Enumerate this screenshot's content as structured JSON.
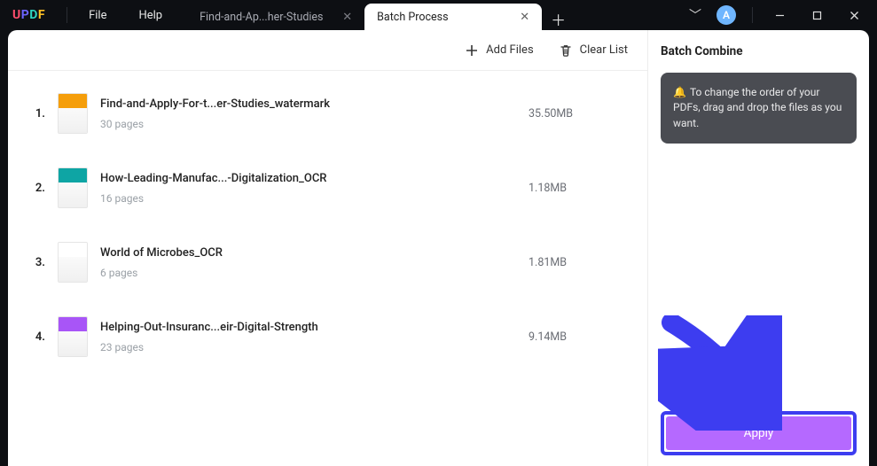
{
  "brand": {
    "u": "U",
    "p": "P",
    "d": "D",
    "f": "F"
  },
  "menus": {
    "file": "File",
    "help": "Help"
  },
  "tabs": {
    "inactive_label": "Find-and-Ap...her-Studies",
    "active_label": "Batch Process"
  },
  "avatar_initial": "A",
  "toolbar": {
    "add_files": "Add Files",
    "clear_list": "Clear List"
  },
  "files": [
    {
      "idx": "1.",
      "name": "Find-and-Apply-For-t...er-Studies_watermark",
      "pages": "30 pages",
      "size": "35.50MB",
      "thumb_color": "#f59e0b"
    },
    {
      "idx": "2.",
      "name": "How-Leading-Manufac...-Digitalization_OCR",
      "pages": "16 pages",
      "size": "1.18MB",
      "thumb_color": "#0ea5a4"
    },
    {
      "idx": "3.",
      "name": "World of Microbes_OCR",
      "pages": "6 pages",
      "size": "1.81MB",
      "thumb_color": "#ffffff"
    },
    {
      "idx": "4.",
      "name": "Helping-Out-Insuranc...eir-Digital-Strength",
      "pages": "23 pages",
      "size": "9.14MB",
      "thumb_color": "#a855f7"
    }
  ],
  "panel": {
    "title": "Batch Combine",
    "tip": "To change the order of your PDFs, drag and drop the files as you want.",
    "apply": "Apply"
  }
}
